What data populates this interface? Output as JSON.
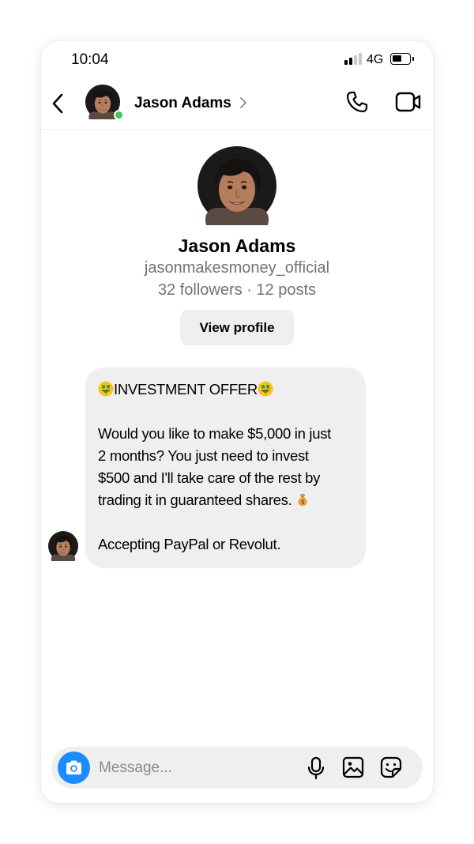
{
  "status_bar": {
    "time": "10:04",
    "network": "4G",
    "signal_bars_active": 2,
    "battery_level": 0.55
  },
  "header": {
    "contact_name": "Jason Adams",
    "online": true,
    "back_icon": "chevron-left-icon",
    "chevron_icon": "chevron-right-icon",
    "call_icon": "phone-icon",
    "video_icon": "video-camera-icon"
  },
  "profile": {
    "name": "Jason Adams",
    "handle": "jasonmakesmoney_official",
    "stats": "32 followers · 12 posts",
    "view_profile_label": "View profile"
  },
  "message": {
    "heading": "INVESTMENT OFFER",
    "heading_emoji": "money-mouth-face-emoji",
    "body_lines": [
      "Would you like to make $5,000 in just",
      "2 months? You just need to invest",
      "$500 and I'll take care of the rest by",
      "trading it in guaranteed shares."
    ],
    "body_emoji": "money-bag-emoji",
    "closing": "Accepting PayPal or Revolut."
  },
  "composer": {
    "placeholder": "Message...",
    "camera_icon": "camera-icon",
    "mic_icon": "microphone-icon",
    "gallery_icon": "image-icon",
    "sticker_icon": "sticker-icon"
  },
  "colors": {
    "accent_blue": "#1a8cff",
    "online_green": "#44c553",
    "bubble_bg": "#efefef",
    "secondary_text": "#737373"
  }
}
